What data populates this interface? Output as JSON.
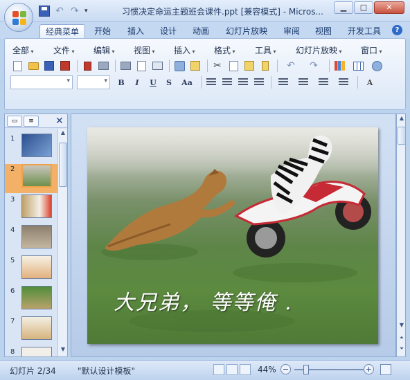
{
  "window": {
    "title": "习惯决定命运主题班会课件.ppt [兼容模式] - Micros...",
    "minimize": "▁",
    "maximize": "□",
    "close": "✕"
  },
  "quick_access": {
    "more": "▾"
  },
  "ribbon_tabs": [
    "经典菜单",
    "开始",
    "插入",
    "设计",
    "动画",
    "幻灯片放映",
    "审阅",
    "视图",
    "开发工具"
  ],
  "help": "?",
  "menu": [
    "全部",
    "文件",
    "编辑",
    "视图",
    "插入",
    "格式",
    "工具",
    "幻灯片放映",
    "窗口"
  ],
  "format_buttons": [
    "B",
    "I",
    "U",
    "S",
    "Aa"
  ],
  "font_color_label": "A",
  "panel": {
    "close": "✕",
    "slides": [
      1,
      2,
      3,
      4,
      5,
      6,
      7,
      8
    ],
    "selected": 2
  },
  "slide": {
    "caption": "大兄弟， 等等俺 ."
  },
  "status": {
    "slide_position": "幻灯片 2/34",
    "template": "\"默认设计模板\"",
    "zoom": "44%",
    "zoom_out": "−",
    "zoom_in": "+"
  },
  "colors": {
    "accent": "#2d69c6",
    "selected_thumb": "#f3b067"
  }
}
